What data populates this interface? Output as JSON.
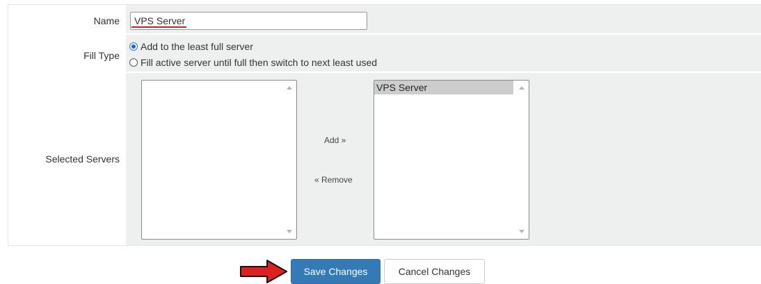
{
  "form": {
    "name": {
      "label": "Name",
      "value": "VPS Server"
    },
    "fill_type": {
      "label": "Fill Type",
      "options": [
        {
          "label": "Add to the least full server",
          "checked": true
        },
        {
          "label": "Fill active server until full then switch to next least used",
          "checked": false
        }
      ]
    },
    "selected_servers": {
      "label": "Selected Servers",
      "available": [],
      "selected": [
        "VPS Server"
      ],
      "add_label": "Add »",
      "remove_label": "« Remove"
    }
  },
  "actions": {
    "save_label": "Save Changes",
    "cancel_label": "Cancel Changes"
  },
  "colors": {
    "accent": "#337ab7",
    "highlight_arrow": "#e02020",
    "underline": "#cc1f1f"
  }
}
